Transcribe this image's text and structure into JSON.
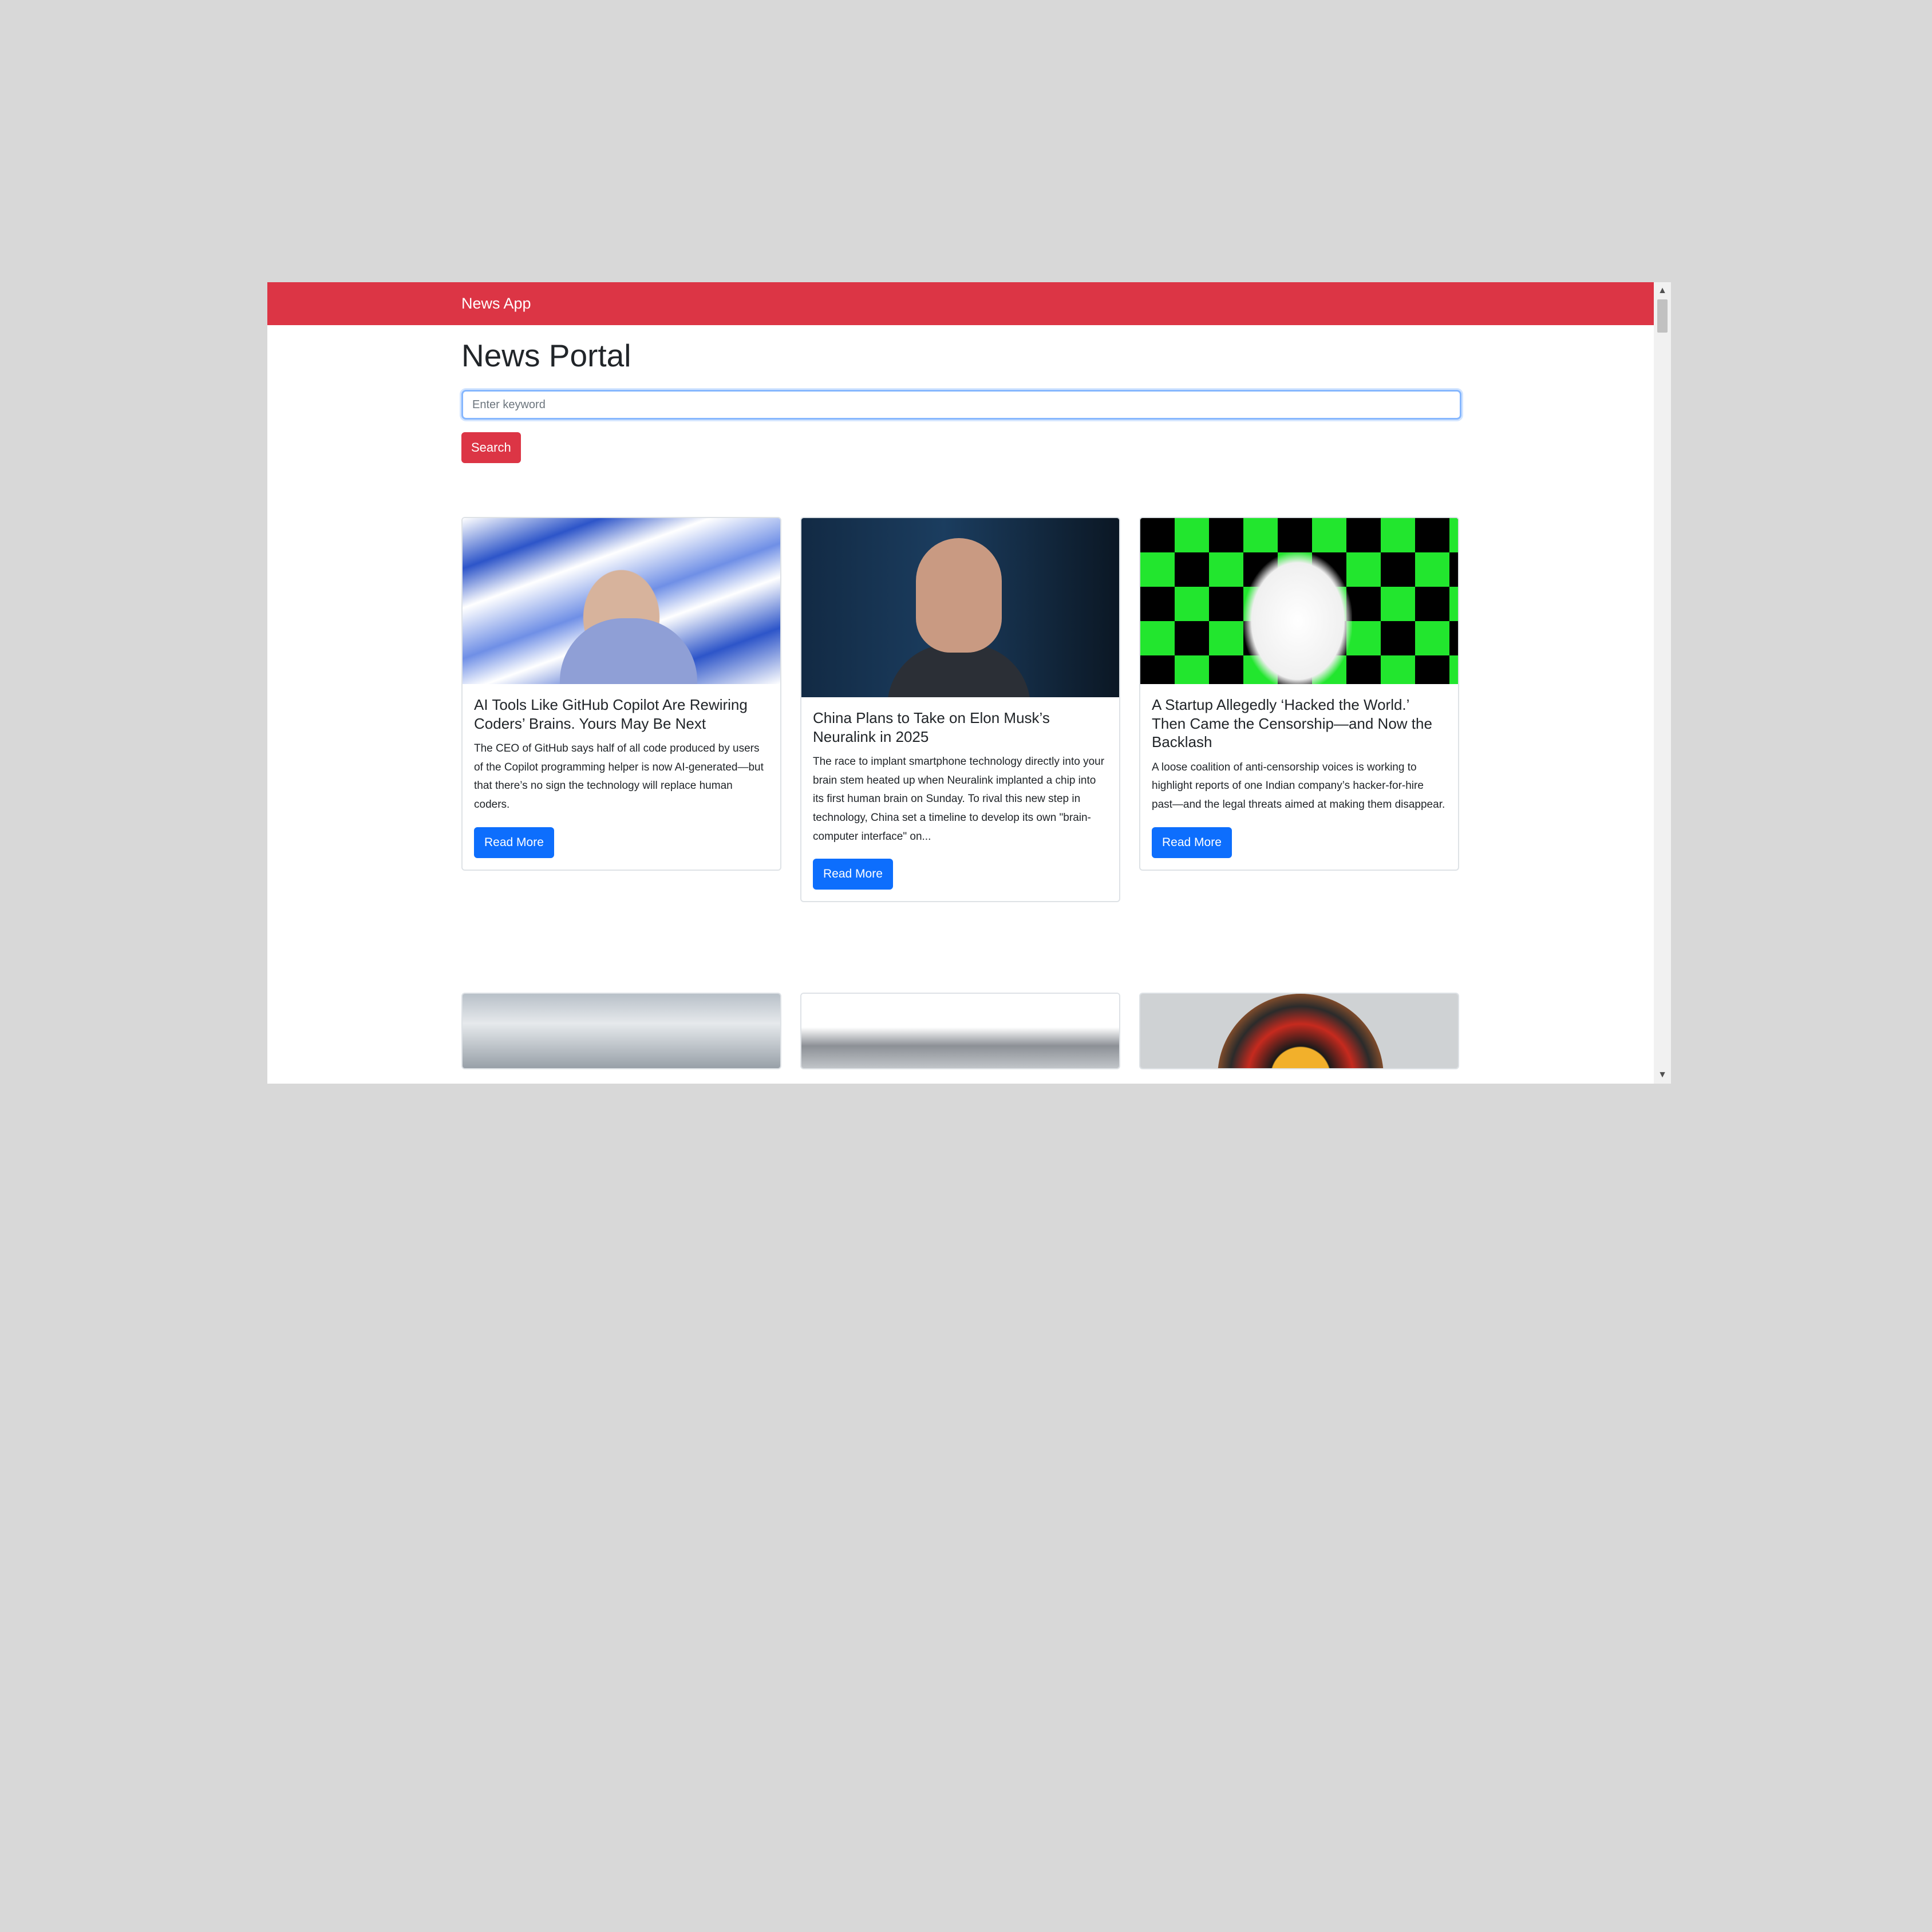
{
  "navbar": {
    "brand": "News App",
    "color": "#dc3545"
  },
  "page": {
    "title": "News Portal"
  },
  "search": {
    "placeholder": "Enter keyword",
    "value": "",
    "button_label": "Search"
  },
  "articles": [
    {
      "title": "AI Tools Like GitHub Copilot Are Rewiring Coders’ Brains. Yours May Be Next",
      "description": "The CEO of GitHub says half of all code produced by users of the Copilot programming helper is now AI-generated—but that there’s no sign the technology will replace human coders.",
      "button_label": "Read More"
    },
    {
      "title": "China Plans to Take on Elon Musk’s Neuralink in 2025",
      "description": "The race to implant smartphone technology directly into your brain stem heated up when Neuralink implanted a chip into its first human brain on Sunday. To rival this new step in technology, China set a timeline to develop its own \"brain-computer interface\" on...",
      "button_label": "Read More"
    },
    {
      "title": "A Startup Allegedly ‘Hacked the World.’ Then Came the Censorship—and Now the Backlash",
      "description": "A loose coalition of anti-censorship voices is working to highlight reports of one Indian company’s hacker-for-hire past—and the legal threats aimed at making them disappear.",
      "button_label": "Read More"
    }
  ],
  "colors": {
    "primary": "#0d6efd",
    "danger": "#dc3545",
    "text": "#212529",
    "background": "#d8d8d8"
  }
}
